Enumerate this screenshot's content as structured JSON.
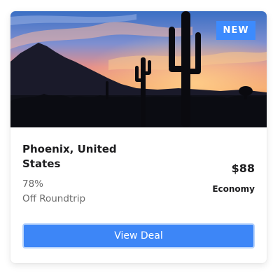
{
  "card": {
    "badge": "NEW",
    "title": "Phoenix, United States",
    "discount_percent": "78%",
    "discount_label": "Off Roundtrip",
    "price": "$88",
    "fare_class": "Economy",
    "button_label": "View Deal",
    "image_icon": "desert-sunset-saguaro-image"
  },
  "colors": {
    "accent": "#3d86f7",
    "badge": "#3d8bfd",
    "text_primary": "#1d1d1f",
    "text_secondary": "#6b6b6b"
  }
}
